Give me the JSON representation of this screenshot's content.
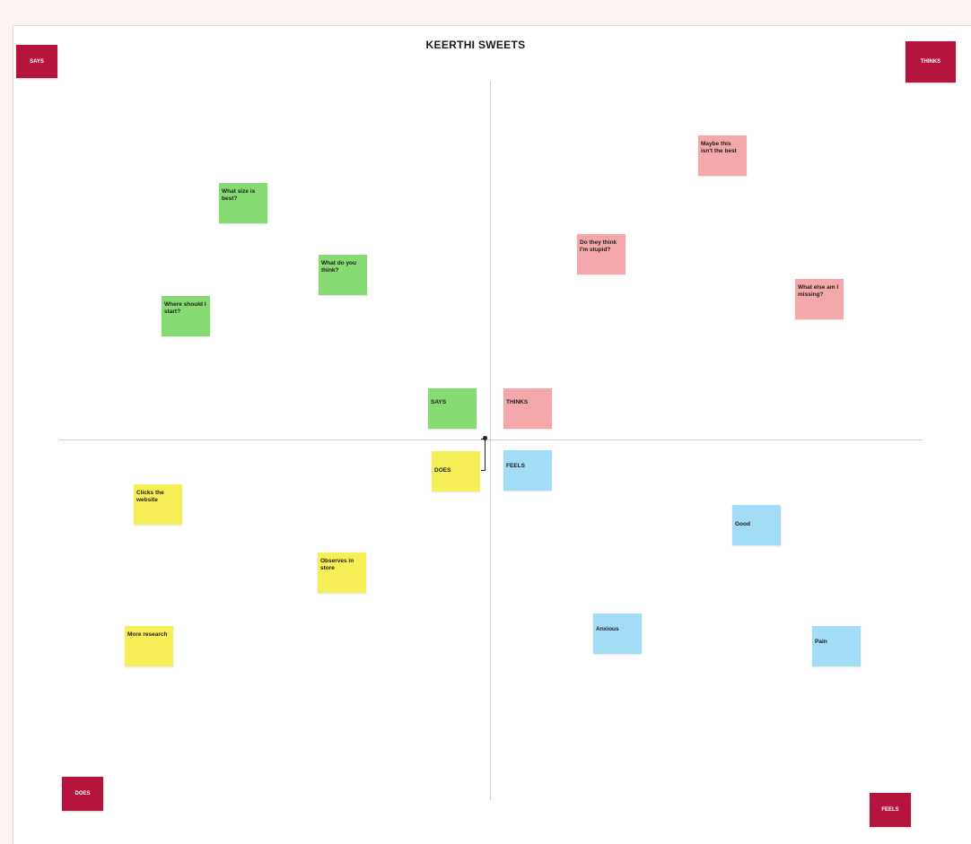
{
  "board": {
    "title": "KEERTHI SWEETS"
  },
  "corners": {
    "says": "SAYS",
    "thinks": "THINKS",
    "does": "DOES",
    "feels": "FEELS"
  },
  "center": {
    "says": "SAYS",
    "thinks": "THINKS",
    "does": "DOES",
    "feels": "FEELS"
  },
  "notes": {
    "says": [
      "What size is best?",
      "What do you think?",
      "Where should I start?"
    ],
    "thinks": [
      "Maybe this isn't the best",
      "Do they think I'm stupid?",
      "What else am I missing?"
    ],
    "does": [
      "Clicks the website",
      "Observes in store",
      "More research"
    ],
    "feels": [
      "Good",
      "Anxious",
      "Pain"
    ]
  },
  "colors": {
    "corner": "#b5143d",
    "says": "#86db73",
    "thinks": "#f5a8ab",
    "does": "#f7ef57",
    "feels": "#a3dcf6"
  }
}
